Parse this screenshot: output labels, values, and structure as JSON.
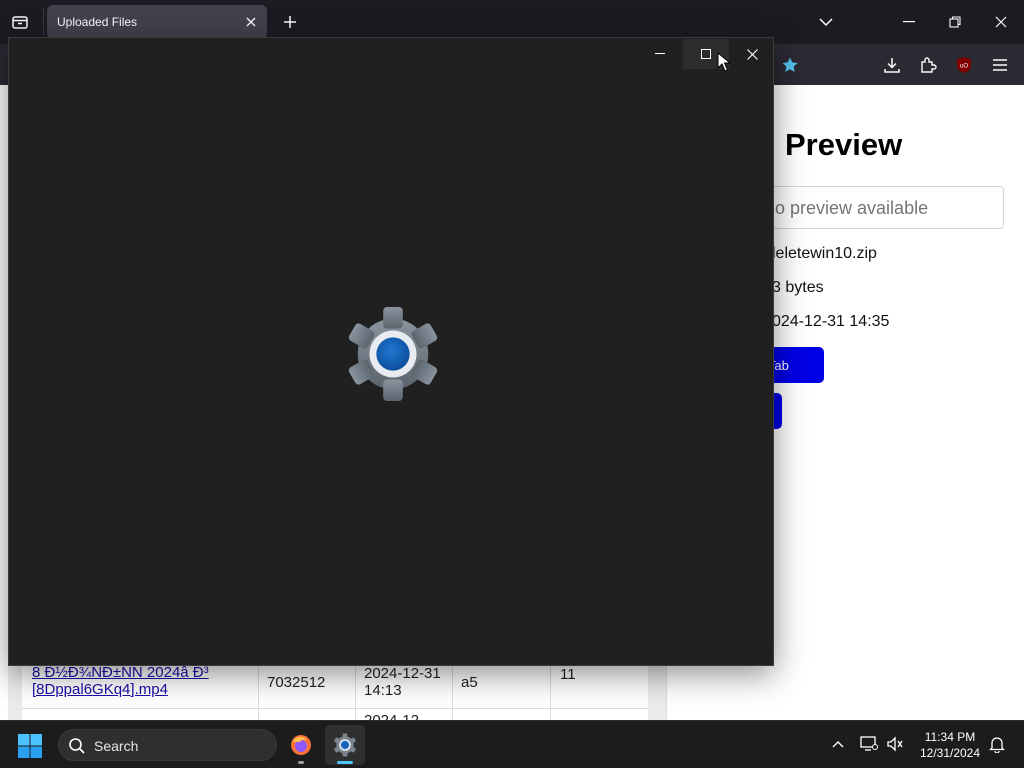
{
  "browser": {
    "tab_title": "Uploaded Files"
  },
  "page": {
    "preview_title": "Preview",
    "preview_placeholder": "o preview available",
    "file_name": "leletewin10.zip",
    "file_size": "3 bytes",
    "file_date": "024-12-31 14:35",
    "open_tab_button": "v Tab",
    "table": {
      "file_link": "8 Ð½Ð¾NÐ±NN 2024â  Ð³ [8Dppal6GKq4].mp4",
      "size": "7032512",
      "date": "2024-12-31 14:13",
      "hash": "a5",
      "count": "11",
      "next_date_partial": "2024-12"
    }
  },
  "taskbar": {
    "search_label": "Search",
    "time": "11:34 PM",
    "date": "12/31/2024"
  },
  "colors": {
    "accent_blue": "#0000e6",
    "settings_bg": "#202020",
    "taskbar_bg": "#1c1c1c",
    "gear_blue": "#1565c0"
  }
}
